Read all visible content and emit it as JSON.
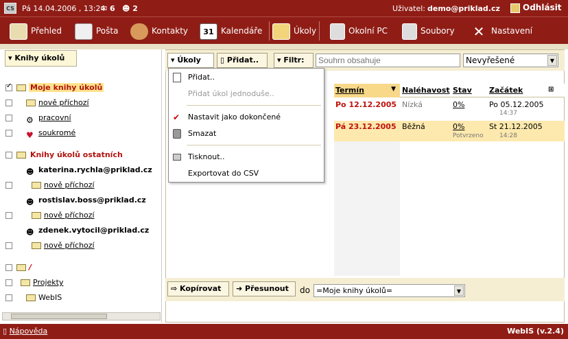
{
  "topbar": {
    "logo": "CS",
    "date": "Pá 14.04.2006 , 13:24",
    "mail_count": "6",
    "contacts_count": "2",
    "user_label": "Uživatel:",
    "user": "demo@priklad.cz",
    "logout": "Odhlásit"
  },
  "nav": [
    {
      "label": "Přehled",
      "icon": "overview-icon"
    },
    {
      "label": "Pošta",
      "icon": "mail-icon"
    },
    {
      "label": "Kontakty",
      "icon": "contacts-icon"
    },
    {
      "label": "Kalendáře",
      "icon": "calendar-icon"
    },
    {
      "label": "Úkoly",
      "icon": "tasks-icon"
    },
    {
      "label": "Okolní PC",
      "icon": "network-pc-icon"
    },
    {
      "label": "Soubory",
      "icon": "files-icon"
    },
    {
      "label": "Nastavení",
      "icon": "tools-icon"
    }
  ],
  "calendar_icon_text": "31",
  "sidebar": {
    "header": "Knihy úkolů",
    "my_books": "Moje knihy úkolů",
    "my_items": [
      "nově příchozí",
      "pracovní",
      "soukromé"
    ],
    "others": "Knihy úkolů ostatních",
    "users": [
      {
        "name": "katerina.rychla@priklad.cz",
        "folder": "nově příchozí"
      },
      {
        "name": "rostislav.boss@priklad.cz",
        "folder": "nově příchozí"
      },
      {
        "name": "zdenek.vytocil@priklad.cz",
        "folder": "nově příchozí"
      }
    ],
    "root": "/",
    "root_items": [
      "Projekty",
      "WebIS"
    ]
  },
  "toolbar": {
    "tasks": "Úkoly",
    "add": "Přidat..",
    "filter": "Filtr:",
    "search_placeholder": "Souhrn obsahuje",
    "status_value": "Nevyřešené"
  },
  "table": {
    "headers": {
      "due": "Termín",
      "urgency": "Naléhavost",
      "status": "Stav",
      "start": "Začátek"
    },
    "rows": [
      {
        "due": "Po 12.12.2005",
        "urgency": "Nízká",
        "status": "0%",
        "status_note": "",
        "start": "Po 05.12.2005",
        "start_time": "14:37"
      },
      {
        "due": "Pá 23.12.2005",
        "urgency": "Běžná",
        "status": "0%",
        "status_note": "Potvrzeno",
        "start": "St 21.12.2005",
        "start_time": "14:28"
      }
    ]
  },
  "menu": {
    "add": "Přidat..",
    "add_simple": "Přidat úkol jednoduše..",
    "mark_done": "Nastavit jako dokončené",
    "delete": "Smazat",
    "print": "Tisknout..",
    "export": "Exportovat do CSV"
  },
  "bottom": {
    "copy": "Kopírovat",
    "move": "Přesunout",
    "to": "do",
    "dest": "=Moje knihy úkolů="
  },
  "footer": {
    "help": "Nápověda",
    "version": "WebIS (v.2.4)"
  },
  "colors": {
    "brand": "#8f1d16",
    "highlight": "#ffe28c",
    "due_red": "#c0110c"
  }
}
